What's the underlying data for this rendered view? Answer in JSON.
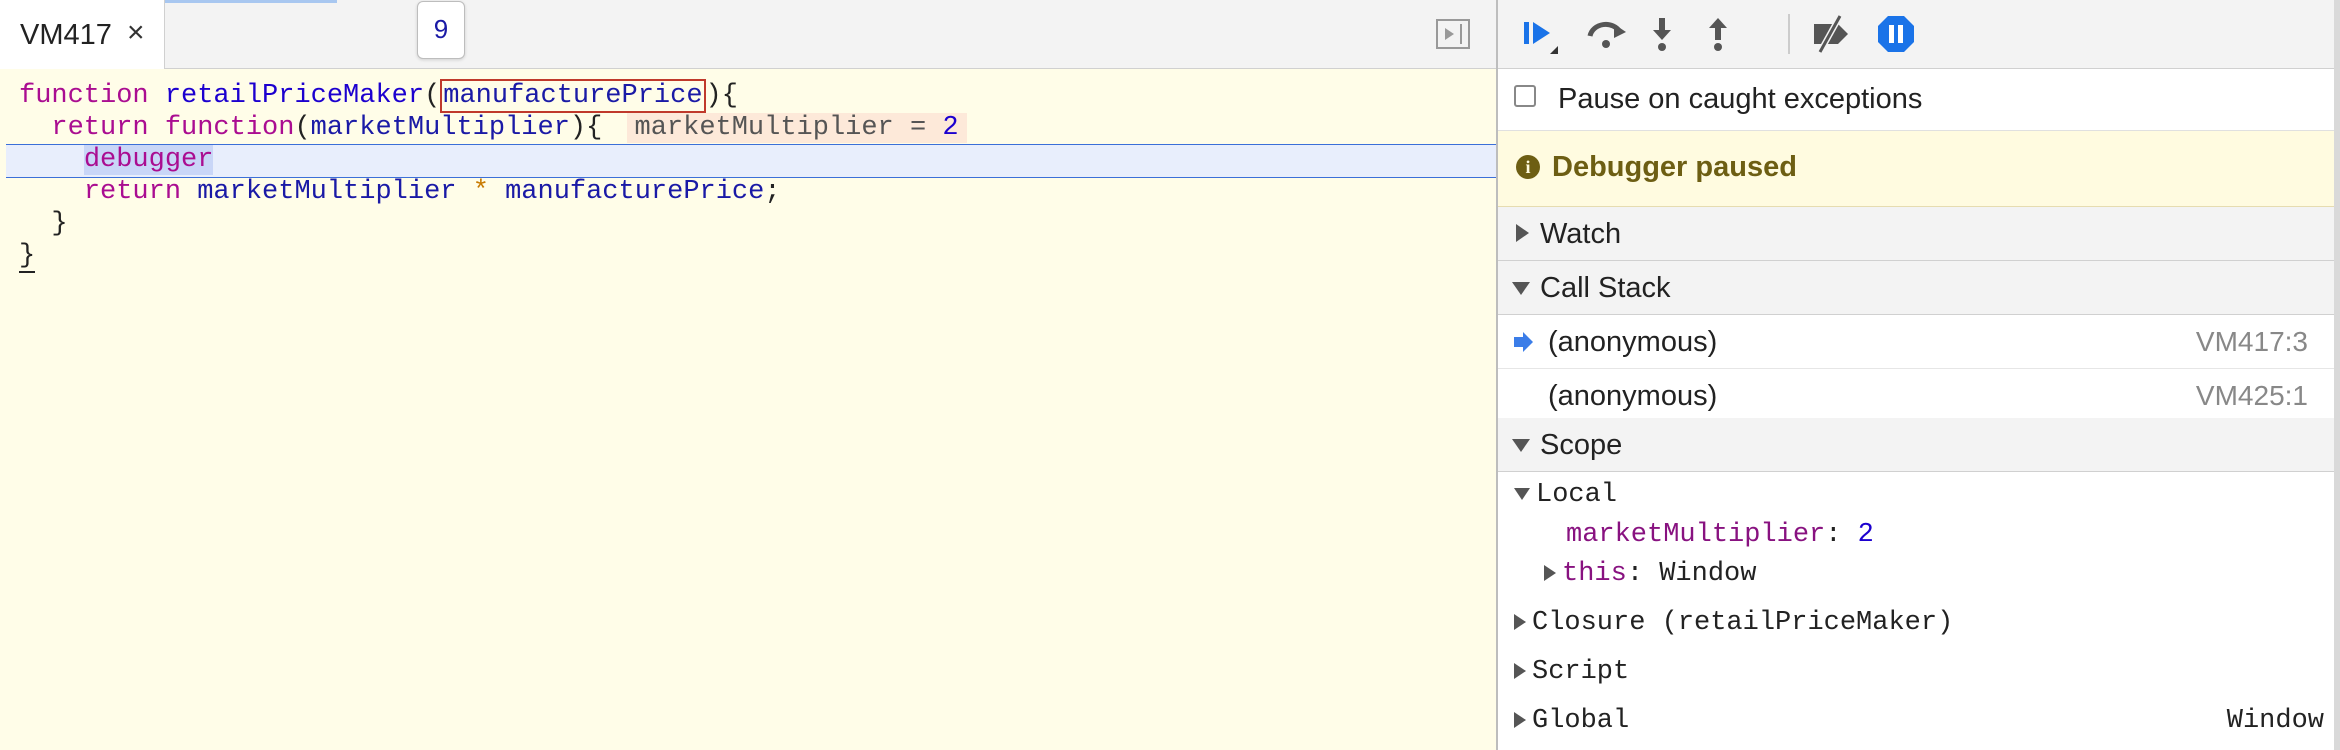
{
  "editor": {
    "tab_label": "VM417",
    "tab_close": "×",
    "popover_value": "9",
    "code": {
      "line1": {
        "kw_function": "function",
        "fn_name": "retailPriceMaker",
        "paren_open": "(",
        "param": "manufacturePrice",
        "paren_close": "){"
      },
      "line2": {
        "kw_return": "return",
        "kw_function": "function",
        "paren_open": "(",
        "param": "marketMultiplier",
        "paren_close": "){",
        "inline_name": "marketMultiplier = ",
        "inline_value": "2"
      },
      "line3": {
        "kw_debugger": "debugger"
      },
      "line4": {
        "kw_return": "return",
        "left": "marketMultiplier",
        "op": "*",
        "right": "manufacturePrice",
        "end": ";"
      },
      "line5": {
        "brace": "}"
      },
      "line6": {
        "brace": "}"
      }
    }
  },
  "sidebar": {
    "toolbar": {
      "resume": "resume-icon",
      "step_over": "step-over-icon",
      "step_into": "step-into-icon",
      "step_out": "step-out-icon",
      "deactivate": "deactivate-breakpoints-icon",
      "pause_exceptions": "pause-on-exceptions-icon"
    },
    "pause_caught_label": "Pause on caught exceptions",
    "paused_banner": {
      "icon_text": "i",
      "label": "Debugger paused"
    },
    "watch_label": "Watch",
    "call_stack": {
      "label": "Call Stack",
      "frames": [
        {
          "name": "(anonymous)",
          "location": "VM417:3"
        },
        {
          "name": "(anonymous)",
          "location": "VM425:1"
        }
      ]
    },
    "scope": {
      "label": "Scope",
      "local_label": "Local",
      "local_props": {
        "market_name": "marketMultiplier",
        "market_value": "2",
        "this_name": "this",
        "this_value": "Window"
      },
      "closure_label": "Closure (retailPriceMaker)",
      "script_label": "Script",
      "global_label": "Global",
      "global_value": "Window"
    }
  },
  "colors": {
    "editor_bg": "#fffde8",
    "keyword": "#aa0d91",
    "function_name": "#1c00cf",
    "execution_line": "#3b6fd8",
    "banner_text": "#6d5e13",
    "toolbar_accent": "#1a73e8"
  }
}
